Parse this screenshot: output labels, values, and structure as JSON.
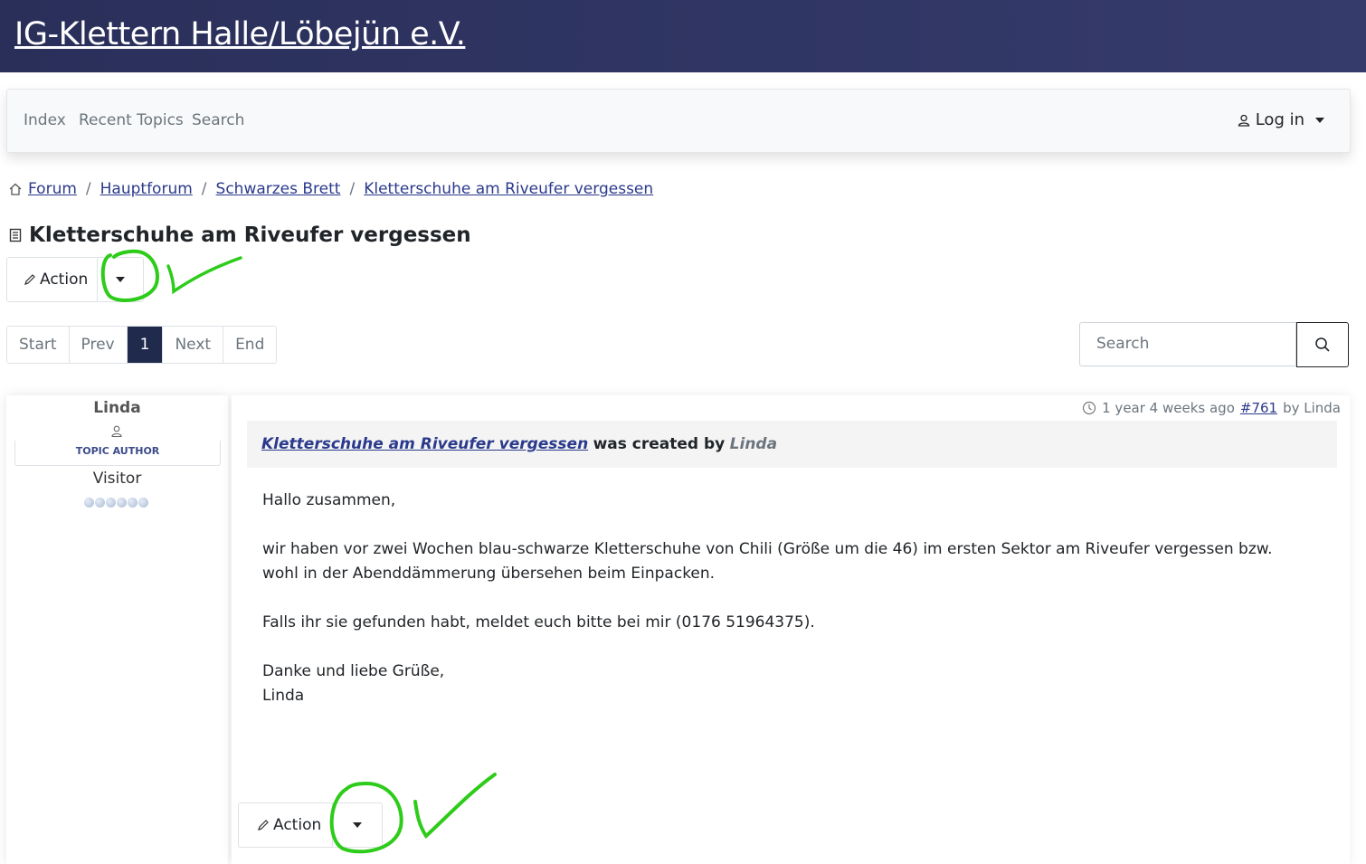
{
  "header": {
    "site_title": "IG-Klettern Halle/Löbejün e.V."
  },
  "nav": {
    "items": [
      "Index",
      "Recent Topics",
      "Search"
    ],
    "login_label": "Log in"
  },
  "breadcrumb": [
    "Forum",
    "Hauptforum",
    "Schwarzes Brett",
    "Kletterschuhe am Riveufer vergessen"
  ],
  "topic": {
    "title": "Kletterschuhe am Riveufer vergessen",
    "action_label": "Action"
  },
  "pagination": [
    "Start",
    "Prev",
    "1",
    "Next",
    "End"
  ],
  "search": {
    "placeholder": "Search"
  },
  "profile": {
    "name": "Linda",
    "role": "TOPIC AUTHOR",
    "rank": "Visitor"
  },
  "post": {
    "time_ago": "1 year 4 weeks ago",
    "post_number": "#761",
    "by_label": "by Linda",
    "header_topic": "Kletterschuhe am Riveufer vergessen",
    "header_created": "was created by",
    "header_author": "Linda",
    "body": [
      "Hallo zusammen,",
      "wir haben vor zwei Wochen blau-schwarze Kletterschuhe von Chili (Größe um die 46) im ersten Sektor am Riveufer vergessen bzw. wohl in der Abenddämmerung übersehen beim Einpacken.",
      "Falls ihr sie gefunden habt, meldet euch bitte bei mir (0176 51964375).",
      "Danke und liebe Grüße,",
      "Linda"
    ],
    "action_label": "Action"
  },
  "annotation_color": "#2ecc1a"
}
